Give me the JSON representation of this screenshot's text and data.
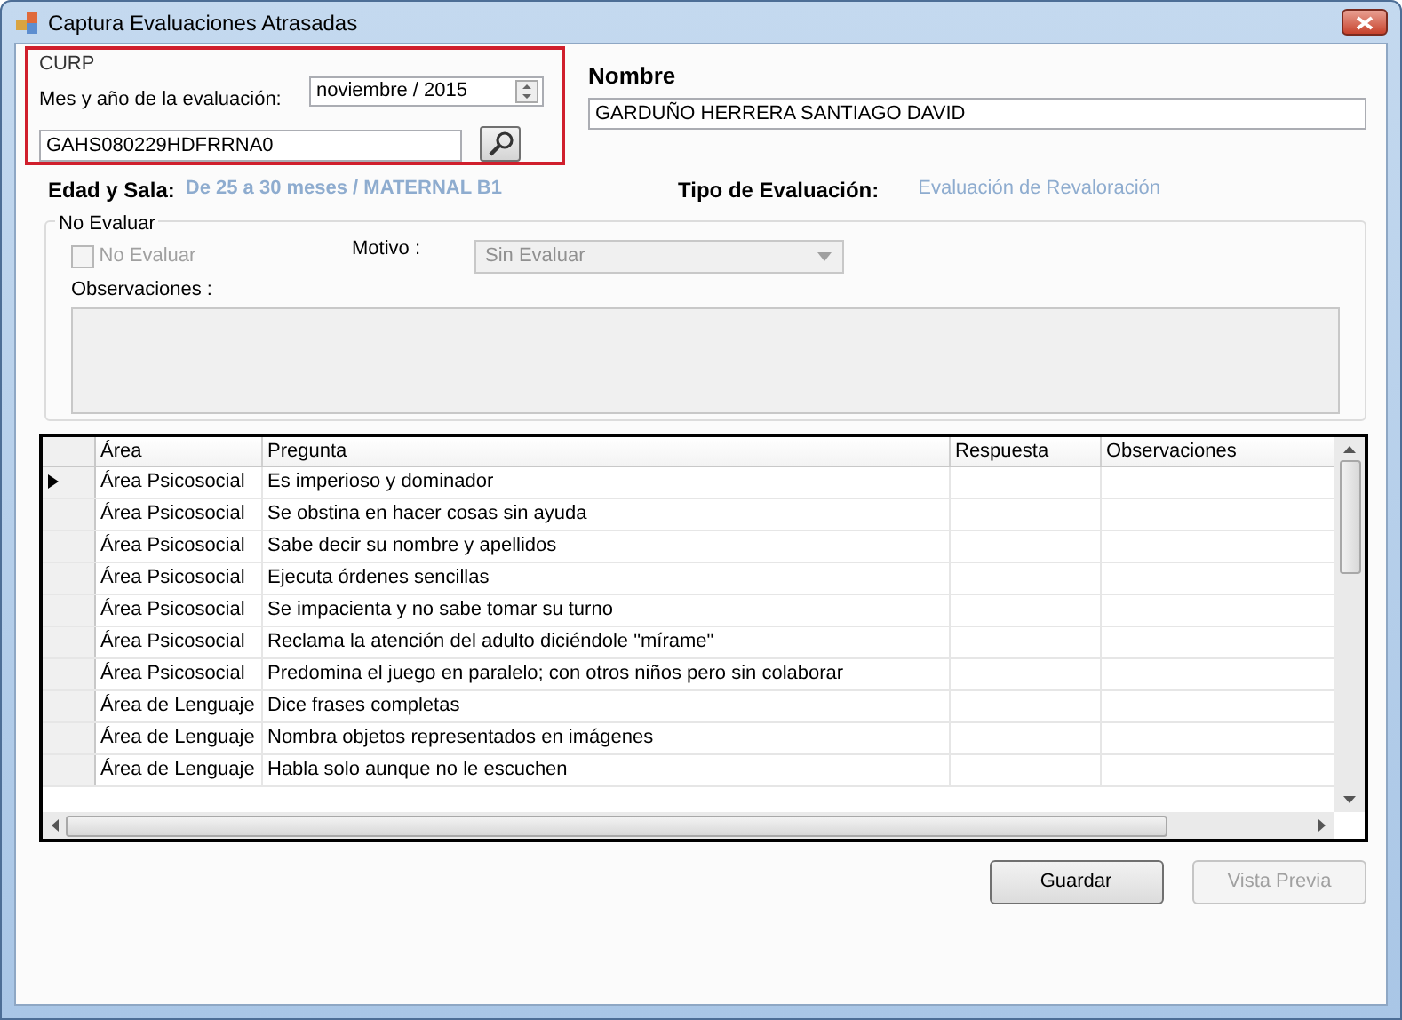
{
  "window": {
    "title": "Captura  Evaluaciones Atrasadas"
  },
  "curp": {
    "legend": "CURP",
    "date_label": "Mes y año de la evaluación:",
    "date_value": "noviembre / 2015",
    "curp_value": "GAHS080229HDFRRNA0"
  },
  "nombre": {
    "label": "Nombre",
    "value": "GARDUÑO HERRERA SANTIAGO DAVID"
  },
  "edad": {
    "label": "Edad y Sala:",
    "value": "De 25 a 30 meses / MATERNAL B1"
  },
  "tipo": {
    "label": "Tipo de Evaluación:",
    "value": "Evaluación de Revaloración"
  },
  "no_evaluar": {
    "legend": "No Evaluar",
    "checkbox": {
      "label": "No Evaluar",
      "checked": false,
      "disabled": true
    },
    "motivo_label": "Motivo :",
    "motivo": {
      "value": "Sin Evaluar",
      "disabled": true
    },
    "observaciones_label": "Observaciones :"
  },
  "grid": {
    "columns": [
      "Área",
      "Pregunta",
      "Respuesta",
      "Observaciones"
    ],
    "rows": [
      {
        "area": "Área Psicosocial",
        "pregunta": "Es imperioso y dominador",
        "selected": true
      },
      {
        "area": "Área Psicosocial",
        "pregunta": "Se obstina en hacer cosas sin ayuda",
        "selected": false
      },
      {
        "area": "Área Psicosocial",
        "pregunta": "Sabe decir su nombre y apellidos",
        "selected": false
      },
      {
        "area": "Área Psicosocial",
        "pregunta": "Ejecuta órdenes sencillas",
        "selected": false
      },
      {
        "area": "Área Psicosocial",
        "pregunta": "Se impacienta y no sabe tomar su turno",
        "selected": false
      },
      {
        "area": "Área Psicosocial",
        "pregunta": "Reclama la atención del adulto diciéndole \"mírame\"",
        "selected": false
      },
      {
        "area": "Área Psicosocial",
        "pregunta": "Predomina el juego en paralelo; con otros niños pero sin colaborar",
        "selected": false
      },
      {
        "area": "Área de Lenguaje",
        "pregunta": "Dice frases completas",
        "selected": false
      },
      {
        "area": "Área de Lenguaje",
        "pregunta": "Nombra objetos representados en imágenes",
        "selected": false
      },
      {
        "area": "Área de Lenguaje",
        "pregunta": "Habla solo aunque no le escuchen",
        "selected": false
      }
    ]
  },
  "buttons": [
    {
      "label": "Guardar",
      "disabled": false
    },
    {
      "label": "Vista Previa",
      "disabled": true
    }
  ]
}
